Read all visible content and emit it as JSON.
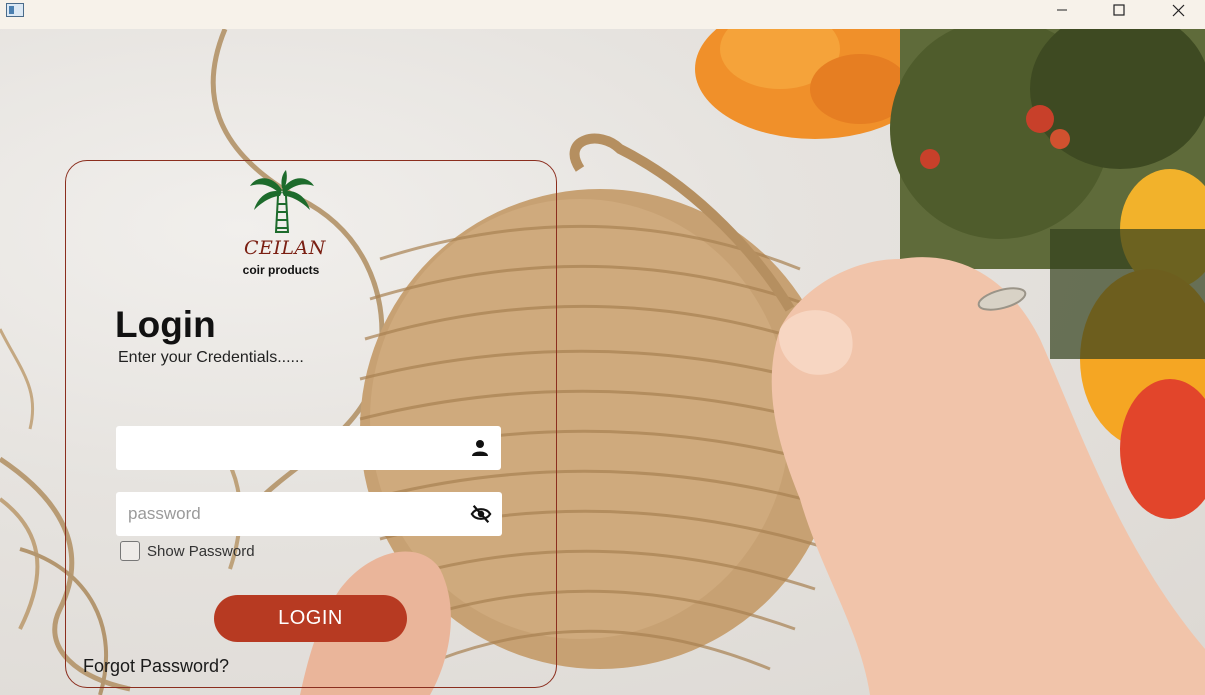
{
  "window": {
    "minimize_icon": "minimize-icon",
    "maximize_icon": "maximize-icon",
    "close_icon": "close-icon"
  },
  "brand": {
    "name": "CEILAN",
    "subtitle": "coir products",
    "logo_icon": "palm-tree-icon"
  },
  "login": {
    "title": "Login",
    "subtitle": "Enter your Credentials......",
    "username": {
      "value": "",
      "placeholder": "",
      "icon": "user-icon"
    },
    "password": {
      "value": "",
      "placeholder": "password",
      "icon": "eye-slash-icon"
    },
    "show_password_label": "Show Password",
    "show_password_checked": false,
    "button_label": "LOGIN",
    "forgot_label": "Forgot Password?"
  },
  "colors": {
    "accent": "#b73a22",
    "card_border": "#8b2e1e",
    "titlebar": "#f7f2ea"
  }
}
